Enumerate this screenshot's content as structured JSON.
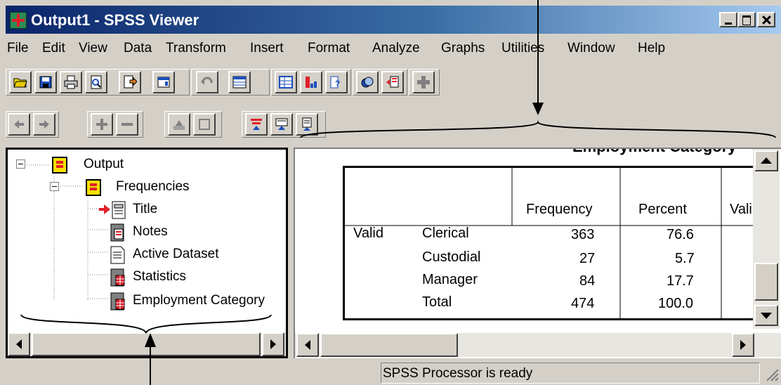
{
  "window": {
    "title": "Output1 - SPSS Viewer",
    "menu": [
      "File",
      "Edit",
      "View",
      "Data",
      "Transform",
      "Insert",
      "Format",
      "Analyze",
      "Graphs",
      "Utilities",
      "Window",
      "Help"
    ]
  },
  "toolbar1": [
    "open-icon",
    "save-icon",
    "print-icon",
    "print-preview-icon",
    "export-icon",
    "dialog-recall-icon",
    "undo-icon",
    "goto-data-icon",
    "goto-chart-icon",
    "variables-icon",
    "use-sets-icon",
    "designate-window-icon",
    "add-icon"
  ],
  "toolbar2": [
    "promote-icon",
    "demote-icon",
    "expand-icon",
    "collapse-icon",
    "show-icon",
    "hide-icon",
    "insert-heading-icon",
    "insert-title-icon",
    "insert-text-icon"
  ],
  "outline": {
    "items": [
      "Output",
      "Frequencies",
      "Title",
      "Notes",
      "Active Dataset",
      "Statistics",
      "Employment Category"
    ]
  },
  "table": {
    "title": "Employment Category",
    "columns": [
      "Frequency",
      "Percent",
      "Vali"
    ],
    "row_group": "Valid",
    "rows": [
      {
        "label": "Clerical",
        "frequency": "363",
        "percent": "76.6"
      },
      {
        "label": "Custodial",
        "frequency": "27",
        "percent": "5.7"
      },
      {
        "label": "Manager",
        "frequency": "84",
        "percent": "17.7"
      },
      {
        "label": "Total",
        "frequency": "474",
        "percent": "100.0"
      }
    ]
  },
  "status": {
    "text": "SPSS Processor is ready"
  },
  "colors": {
    "title_bar": "#0a246a",
    "face": "#d4d0c8",
    "arrow_red": "#e0202a",
    "folder_yellow": "#f5e000"
  }
}
